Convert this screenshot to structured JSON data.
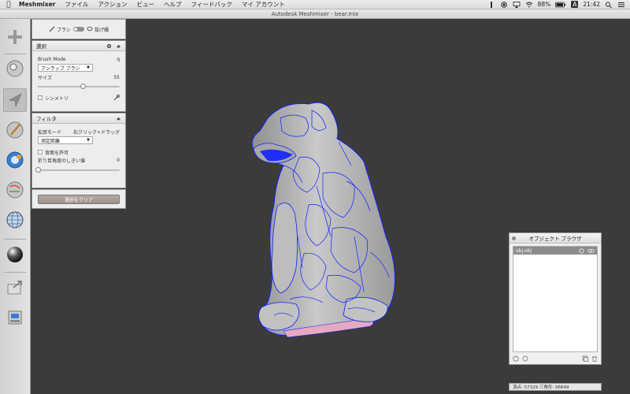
{
  "menubar": {
    "app_name": "Meshmixer",
    "items": [
      "ファイル",
      "アクション",
      "ビュー",
      "ヘルプ",
      "フィードバック",
      "マイ アカウント"
    ],
    "battery": "88%",
    "input_mode": "A",
    "clock": "21:42"
  },
  "window": {
    "title": "Autodesk Meshmixer - bear.mix"
  },
  "brush_bar": {
    "brush_label": "ブラシ",
    "lasso_label": "投げ縄"
  },
  "select_panel": {
    "title": "選択",
    "brush_mode_label": "Brush Mode",
    "brush_mode_key": "q",
    "brush_mode_value": "アンラップ ブラシ",
    "size_label": "サイズ",
    "size_value": "55",
    "size_fraction": 0.55,
    "symmetry_label": "シンメトリ"
  },
  "filter_panel": {
    "title": "フィルタ",
    "expand_mode_label": "拡張モード",
    "expand_mode_hint": "右クリック+ドラッグ",
    "measure_value": "測定距離",
    "backface_label": "背面を許可",
    "crease_label": "折り目角度のしきい値",
    "crease_value": "0",
    "crease_fraction": 0.0
  },
  "clear_button": {
    "label": "選択をクリア"
  },
  "object_browser": {
    "title": "オブジェクト ブラウザ",
    "items": [
      {
        "name": "obj.obj"
      }
    ]
  },
  "status": {
    "text": "頂点: 57329 三角形: 96649"
  },
  "colors": {
    "viewport_bg": "#3b3b3b",
    "selection_edges": "#1020ff",
    "mesh": "#b9b9b9"
  }
}
